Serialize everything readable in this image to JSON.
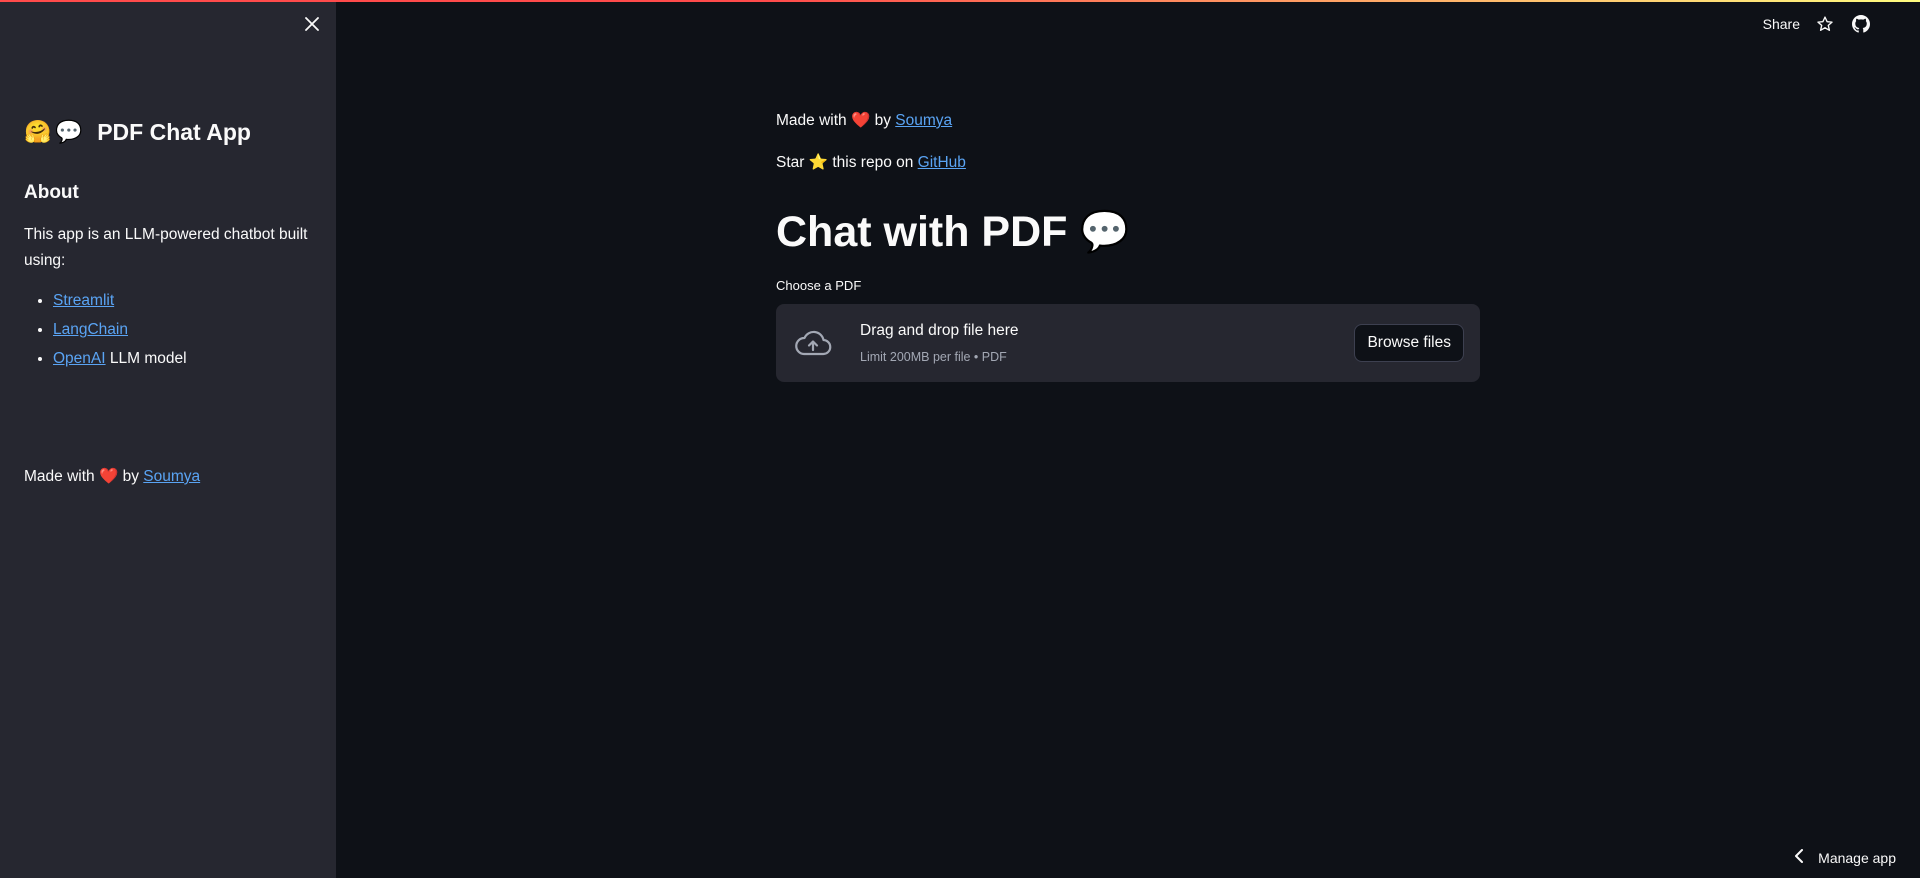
{
  "sidebar": {
    "title": "PDF Chat App",
    "title_icons": [
      "hugging-face-emoji",
      "speech-bubble-emoji"
    ],
    "about_heading": "About",
    "description": "This app is an LLM-powered chatbot built using:",
    "items": [
      {
        "link": "Streamlit",
        "suffix": ""
      },
      {
        "link": "LangChain",
        "suffix": ""
      },
      {
        "link": "OpenAI",
        "suffix": " LLM model"
      }
    ],
    "made_prefix": "Made with",
    "made_by": " by ",
    "made_author": "Soumya"
  },
  "header": {
    "share_label": "Share"
  },
  "main": {
    "made_prefix": "Made with",
    "made_by": " by ",
    "made_author": "Soumya",
    "star_prefix": "Star",
    "star_mid": " this repo on ",
    "star_link": "GitHub",
    "title": "Chat with PDF",
    "uploader_label": "Choose a PDF",
    "dropzone_text": "Drag and drop file here",
    "dropzone_limit": "Limit 200MB per file • PDF",
    "browse_label": "Browse files"
  },
  "footer": {
    "manage_label": "Manage app"
  },
  "colors": {
    "background": "#0e1117",
    "sidebar": "#262730",
    "link": "#5aa4f4",
    "accent": "#ff4b4b"
  }
}
